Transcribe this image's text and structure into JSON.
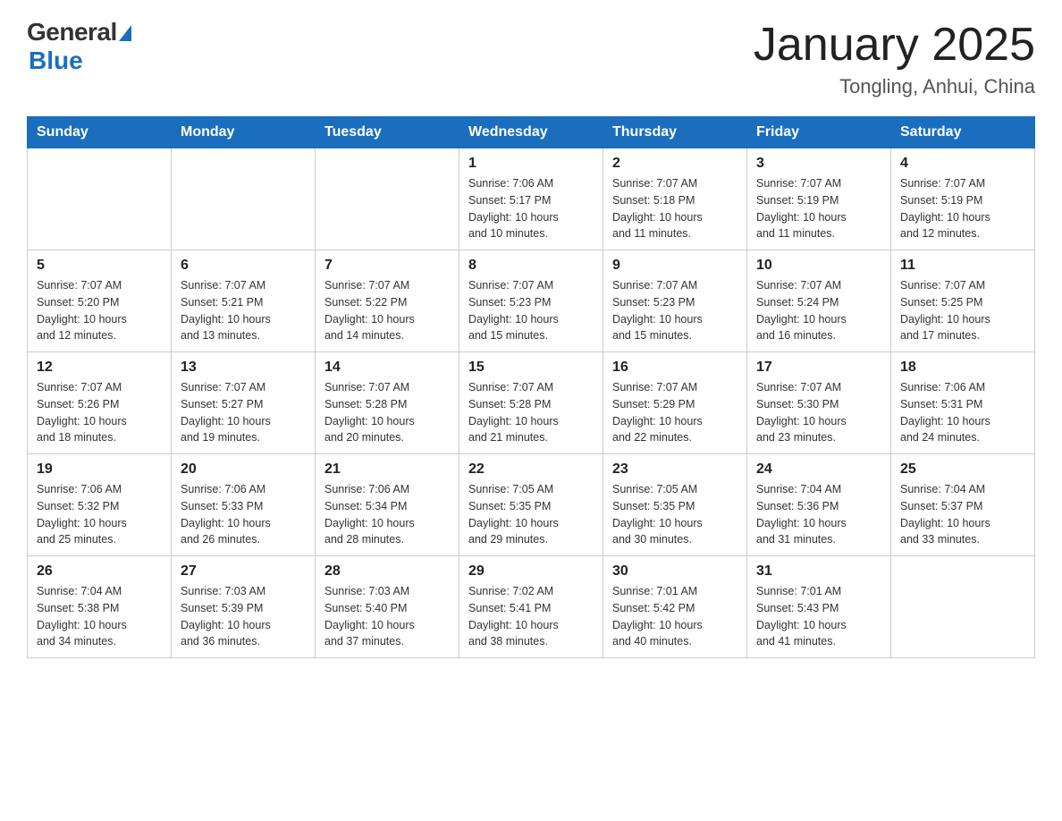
{
  "logo": {
    "general": "General",
    "blue": "Blue",
    "subtitle": "Blue"
  },
  "header": {
    "title": "January 2025",
    "subtitle": "Tongling, Anhui, China"
  },
  "weekdays": [
    "Sunday",
    "Monday",
    "Tuesday",
    "Wednesday",
    "Thursday",
    "Friday",
    "Saturday"
  ],
  "weeks": [
    [
      {
        "day": "",
        "info": ""
      },
      {
        "day": "",
        "info": ""
      },
      {
        "day": "",
        "info": ""
      },
      {
        "day": "1",
        "info": "Sunrise: 7:06 AM\nSunset: 5:17 PM\nDaylight: 10 hours\nand 10 minutes."
      },
      {
        "day": "2",
        "info": "Sunrise: 7:07 AM\nSunset: 5:18 PM\nDaylight: 10 hours\nand 11 minutes."
      },
      {
        "day": "3",
        "info": "Sunrise: 7:07 AM\nSunset: 5:19 PM\nDaylight: 10 hours\nand 11 minutes."
      },
      {
        "day": "4",
        "info": "Sunrise: 7:07 AM\nSunset: 5:19 PM\nDaylight: 10 hours\nand 12 minutes."
      }
    ],
    [
      {
        "day": "5",
        "info": "Sunrise: 7:07 AM\nSunset: 5:20 PM\nDaylight: 10 hours\nand 12 minutes."
      },
      {
        "day": "6",
        "info": "Sunrise: 7:07 AM\nSunset: 5:21 PM\nDaylight: 10 hours\nand 13 minutes."
      },
      {
        "day": "7",
        "info": "Sunrise: 7:07 AM\nSunset: 5:22 PM\nDaylight: 10 hours\nand 14 minutes."
      },
      {
        "day": "8",
        "info": "Sunrise: 7:07 AM\nSunset: 5:23 PM\nDaylight: 10 hours\nand 15 minutes."
      },
      {
        "day": "9",
        "info": "Sunrise: 7:07 AM\nSunset: 5:23 PM\nDaylight: 10 hours\nand 15 minutes."
      },
      {
        "day": "10",
        "info": "Sunrise: 7:07 AM\nSunset: 5:24 PM\nDaylight: 10 hours\nand 16 minutes."
      },
      {
        "day": "11",
        "info": "Sunrise: 7:07 AM\nSunset: 5:25 PM\nDaylight: 10 hours\nand 17 minutes."
      }
    ],
    [
      {
        "day": "12",
        "info": "Sunrise: 7:07 AM\nSunset: 5:26 PM\nDaylight: 10 hours\nand 18 minutes."
      },
      {
        "day": "13",
        "info": "Sunrise: 7:07 AM\nSunset: 5:27 PM\nDaylight: 10 hours\nand 19 minutes."
      },
      {
        "day": "14",
        "info": "Sunrise: 7:07 AM\nSunset: 5:28 PM\nDaylight: 10 hours\nand 20 minutes."
      },
      {
        "day": "15",
        "info": "Sunrise: 7:07 AM\nSunset: 5:28 PM\nDaylight: 10 hours\nand 21 minutes."
      },
      {
        "day": "16",
        "info": "Sunrise: 7:07 AM\nSunset: 5:29 PM\nDaylight: 10 hours\nand 22 minutes."
      },
      {
        "day": "17",
        "info": "Sunrise: 7:07 AM\nSunset: 5:30 PM\nDaylight: 10 hours\nand 23 minutes."
      },
      {
        "day": "18",
        "info": "Sunrise: 7:06 AM\nSunset: 5:31 PM\nDaylight: 10 hours\nand 24 minutes."
      }
    ],
    [
      {
        "day": "19",
        "info": "Sunrise: 7:06 AM\nSunset: 5:32 PM\nDaylight: 10 hours\nand 25 minutes."
      },
      {
        "day": "20",
        "info": "Sunrise: 7:06 AM\nSunset: 5:33 PM\nDaylight: 10 hours\nand 26 minutes."
      },
      {
        "day": "21",
        "info": "Sunrise: 7:06 AM\nSunset: 5:34 PM\nDaylight: 10 hours\nand 28 minutes."
      },
      {
        "day": "22",
        "info": "Sunrise: 7:05 AM\nSunset: 5:35 PM\nDaylight: 10 hours\nand 29 minutes."
      },
      {
        "day": "23",
        "info": "Sunrise: 7:05 AM\nSunset: 5:35 PM\nDaylight: 10 hours\nand 30 minutes."
      },
      {
        "day": "24",
        "info": "Sunrise: 7:04 AM\nSunset: 5:36 PM\nDaylight: 10 hours\nand 31 minutes."
      },
      {
        "day": "25",
        "info": "Sunrise: 7:04 AM\nSunset: 5:37 PM\nDaylight: 10 hours\nand 33 minutes."
      }
    ],
    [
      {
        "day": "26",
        "info": "Sunrise: 7:04 AM\nSunset: 5:38 PM\nDaylight: 10 hours\nand 34 minutes."
      },
      {
        "day": "27",
        "info": "Sunrise: 7:03 AM\nSunset: 5:39 PM\nDaylight: 10 hours\nand 36 minutes."
      },
      {
        "day": "28",
        "info": "Sunrise: 7:03 AM\nSunset: 5:40 PM\nDaylight: 10 hours\nand 37 minutes."
      },
      {
        "day": "29",
        "info": "Sunrise: 7:02 AM\nSunset: 5:41 PM\nDaylight: 10 hours\nand 38 minutes."
      },
      {
        "day": "30",
        "info": "Sunrise: 7:01 AM\nSunset: 5:42 PM\nDaylight: 10 hours\nand 40 minutes."
      },
      {
        "day": "31",
        "info": "Sunrise: 7:01 AM\nSunset: 5:43 PM\nDaylight: 10 hours\nand 41 minutes."
      },
      {
        "day": "",
        "info": ""
      }
    ]
  ]
}
